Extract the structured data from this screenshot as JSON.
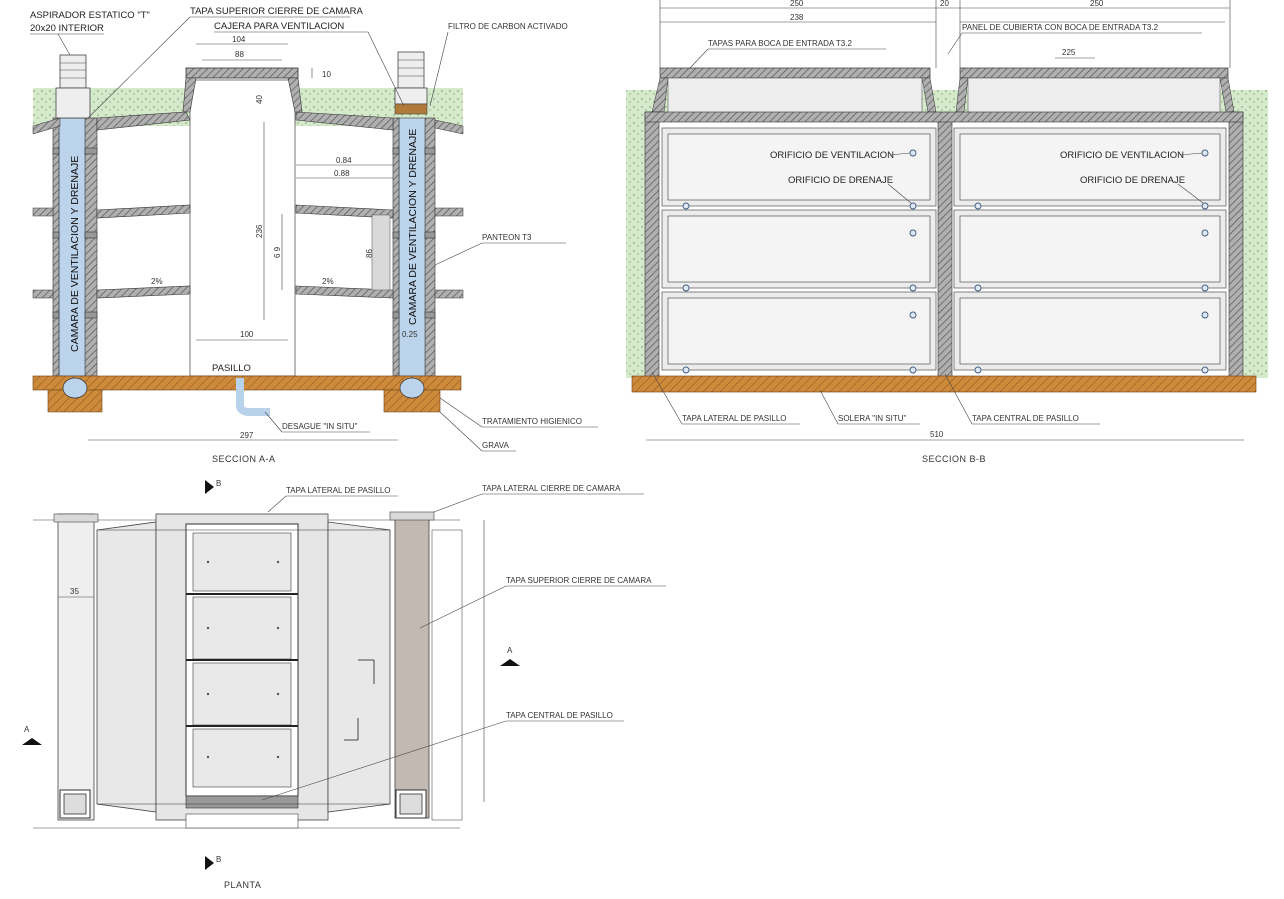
{
  "section_aa": {
    "labels": {
      "aspirador_1": "ASPIRADOR ESTATICO \"T\"",
      "aspirador_2": "20x20 INTERIOR",
      "tapa_superior": "TAPA SUPERIOR CIERRE DE CAMARA",
      "cajera": "CAJERA PARA VENTILACION",
      "filtro": "FILTRO DE CARBON ACTIVADO",
      "camara_left": "CAMARA DE VENTILACION Y DRENAJE",
      "camara_right": "CAMARA DE VENTILACION Y DRENAJE",
      "panteon": "PANTEON  T3",
      "pasillo": "PASILLO",
      "desague": "DESAGUE \"IN SITU\"",
      "tratamiento": "TRATAMIENTO HIGIENICO",
      "grava": "GRAVA"
    },
    "dims": {
      "d104": "104",
      "d88": "88",
      "d10": "10",
      "d40": "40",
      "d084": "0.84",
      "d088": "0.88",
      "d236": "236",
      "d69": "6  9",
      "d86": "86",
      "d100": "100",
      "d025": "0.25",
      "slope1": "2%",
      "slope2": "2%",
      "total": "297"
    },
    "title": "SECCION A-A"
  },
  "section_bb": {
    "labels": {
      "tapas_boca": "TAPAS PARA BOCA DE ENTRADA  T3.2",
      "panel_cubierta": "PANEL DE CUBIERTA CON BOCA DE ENTRADA T3.2",
      "vent_left": "ORIFICIO DE VENTILACION",
      "drenaje_left": "ORIFICIO DE DRENAJE",
      "vent_right": "ORIFICIO DE VENTILACION",
      "drenaje_right": "ORIFICIO DE DRENAJE",
      "tapa_lateral": "TAPA LATERAL DE PASILLO",
      "solera": "SOLERA \"IN SITU\"",
      "tapa_central": "TAPA CENTRAL DE PASILLO"
    },
    "dims": {
      "top_left": "250",
      "top_mid": "20",
      "top_right": "250",
      "sub_left": "238",
      "sub_right": "225",
      "total": "510"
    },
    "title": "SECCION B-B"
  },
  "planta": {
    "labels": {
      "tapa_lateral": "TAPA LATERAL DE PASILLO",
      "tapa_lateral_camara": "TAPA LATERAL CIERRE DE CAMARA",
      "tapa_superior": "TAPA SUPERIOR CIERRE DE CAMARA",
      "tapa_central": "TAPA CENTRAL DE PASILLO"
    },
    "dims": {
      "d35": "35"
    },
    "marks": {
      "b_top": "B",
      "b_bottom": "B",
      "a_left": "A",
      "a_right": "A"
    },
    "title": "PLANTA"
  },
  "colors": {
    "ground": "#cfe6c4",
    "soil": "#cd8a3a",
    "camera_blue": "#bcd3ec",
    "wall_hatch": "#8a8a8a",
    "panel": "#ececec",
    "brown_panel": "#c3b9b3"
  }
}
